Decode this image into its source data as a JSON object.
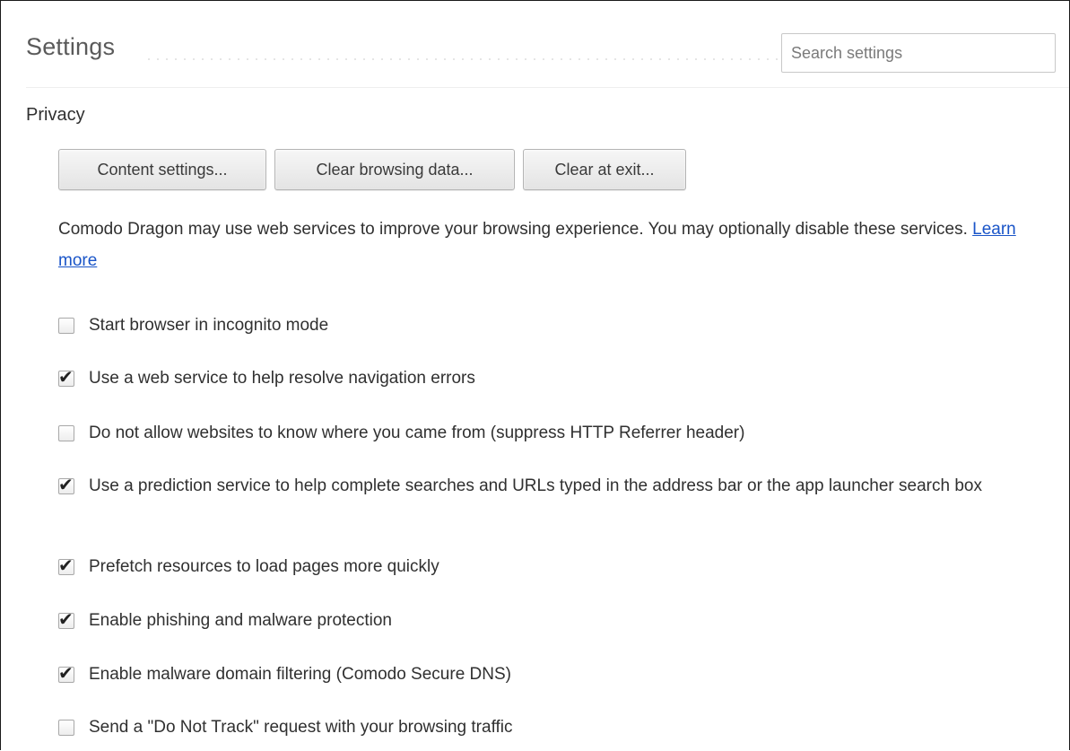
{
  "header": {
    "title": "Settings",
    "search_placeholder": "Search settings"
  },
  "privacy": {
    "section_title": "Privacy",
    "buttons": {
      "content_settings": "Content settings...",
      "clear_browsing_data": "Clear browsing data...",
      "clear_at_exit": "Clear at exit..."
    },
    "description": "Comodo Dragon may use web services to improve your browsing experience. You may optionally disable these services.",
    "learn_more": "Learn more",
    "options": [
      {
        "label": "Start browser in incognito mode",
        "checked": false
      },
      {
        "label": "Use a web service to help resolve navigation errors",
        "checked": true
      },
      {
        "label": "Do not allow websites to know where you came from (suppress HTTP Referrer header)",
        "checked": false
      },
      {
        "label": "Use a prediction service to help complete searches and URLs typed in the address bar or the app launcher search box",
        "checked": true
      },
      {
        "label": "Prefetch resources to load pages more quickly",
        "checked": true
      },
      {
        "label": "Enable phishing and malware protection",
        "checked": true
      },
      {
        "label": "Enable malware domain filtering (Comodo Secure DNS)",
        "checked": true
      },
      {
        "label": "Send a \"Do Not Track\" request with your browsing traffic",
        "checked": false
      }
    ]
  },
  "colors": {
    "link": "#1a55c8",
    "text": "#303030",
    "title": "#5a5a5a"
  },
  "icons": {
    "checkmark": "checkmark-icon"
  }
}
